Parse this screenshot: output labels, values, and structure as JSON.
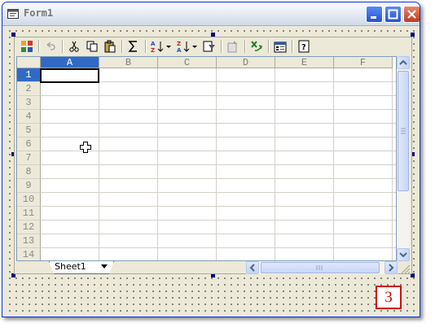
{
  "window": {
    "title": "Form1"
  },
  "columns": [
    "A",
    "B",
    "C",
    "D",
    "E",
    "F"
  ],
  "rows": [
    "1",
    "2",
    "3",
    "4",
    "5",
    "6",
    "7",
    "8",
    "9",
    "10",
    "11",
    "12",
    "13",
    "14"
  ],
  "active_cell": {
    "column": "A",
    "row": "1"
  },
  "sheet_tab": {
    "label": "Sheet1"
  },
  "badge": {
    "value": "3"
  },
  "colors": {
    "selection": "#316ac5",
    "badge": "#d10000"
  }
}
